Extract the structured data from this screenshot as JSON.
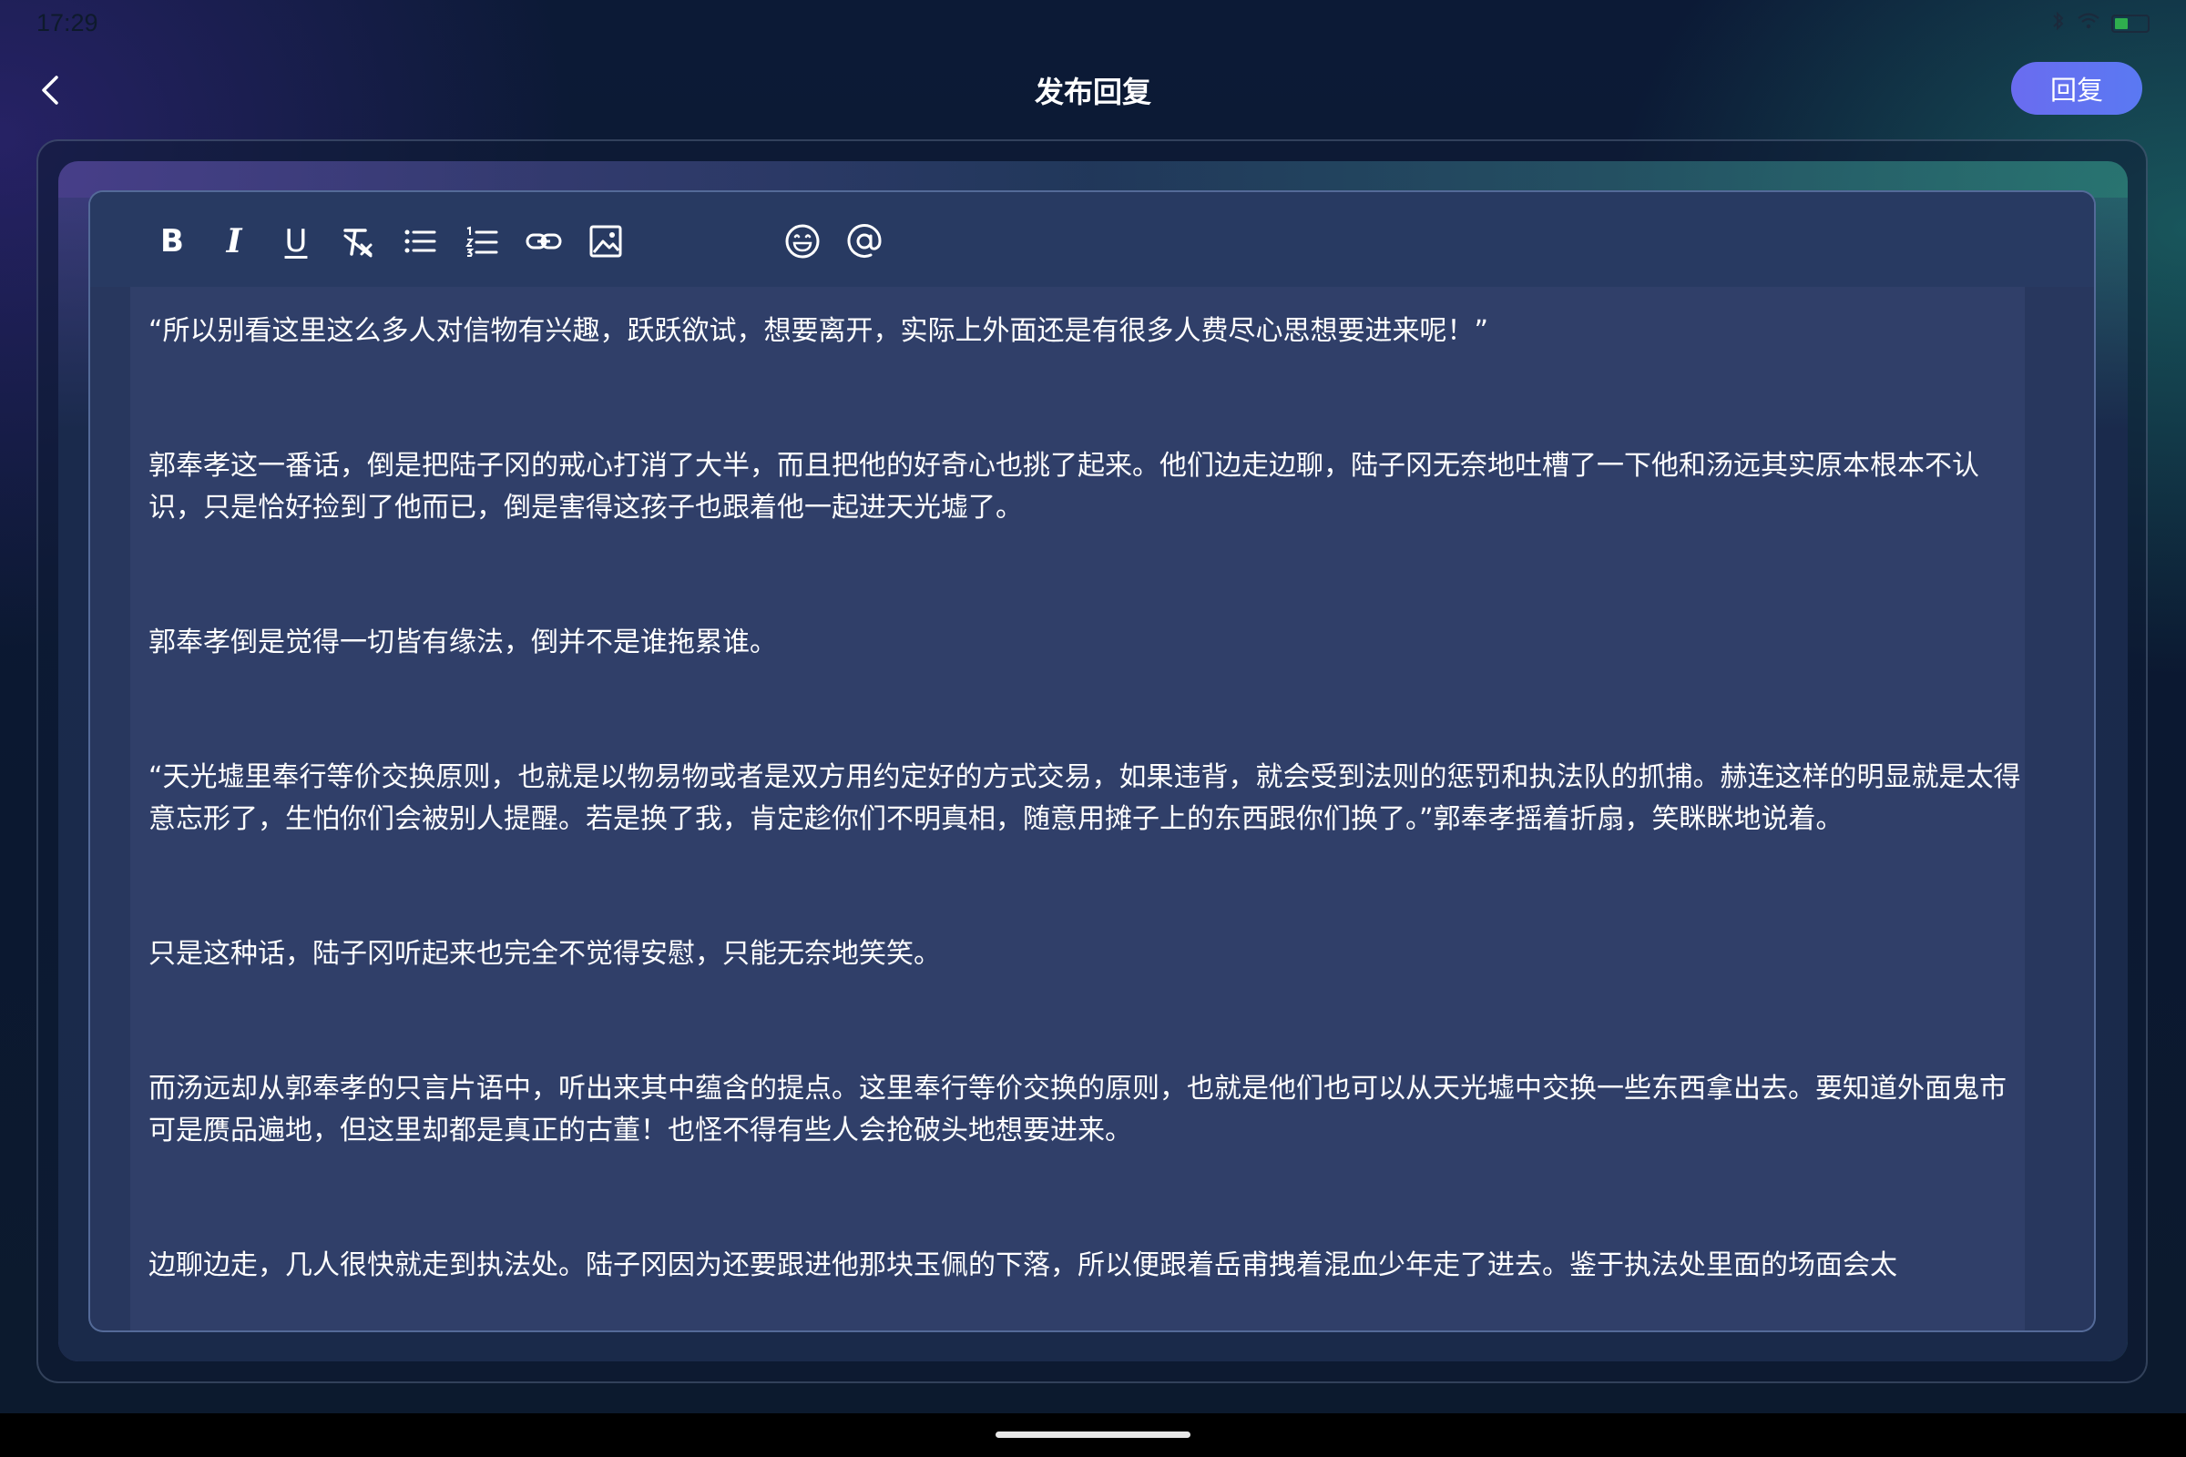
{
  "status_bar": {
    "time": "17:29"
  },
  "header": {
    "title": "发布回复",
    "reply_label": "回复"
  },
  "toolbar": {
    "tools": [
      "bold-icon",
      "italic-icon",
      "underline-icon",
      "clear-format-icon",
      "bullet-list-icon",
      "numbered-list-icon",
      "link-icon",
      "image-icon",
      "emoji-icon",
      "mention-icon"
    ],
    "bold_glyph": "B",
    "italic_glyph": "I",
    "underline_glyph": "U"
  },
  "editor": {
    "paragraphs": [
      "“所以别看这里这么多人对信物有兴趣，跃跃欲试，想要离开，实际上外面还是有很多人费尽心思想要进来呢！”",
      "郭奉孝这一番话，倒是把陆子冈的戒心打消了大半，而且把他的好奇心也挑了起来。他们边走边聊，陆子冈无奈地吐槽了一下他和汤远其实原本根本不认识，只是恰好捡到了他而已，倒是害得这孩子也跟着他一起进天光墟了。",
      "郭奉孝倒是觉得一切皆有缘法，倒并不是谁拖累谁。",
      "“天光墟里奉行等价交换原则，也就是以物易物或者是双方用约定好的方式交易，如果违背，就会受到法则的惩罚和执法队的抓捕。赫连这样的明显就是太得意忘形了，生怕你们会被别人提醒。若是换了我，肯定趁你们不明真相，随意用摊子上的东西跟你们换了。”郭奉孝摇着折扇，笑眯眯地说着。",
      "只是这种话，陆子冈听起来也完全不觉得安慰，只能无奈地笑笑。",
      "而汤远却从郭奉孝的只言片语中，听出来其中蕴含的提点。这里奉行等价交换的原则，也就是他们也可以从天光墟中交换一些东西拿出去。要知道外面鬼市可是赝品遍地，但这里却都是真正的古董！也怪不得有些人会抢破头地想要进来。",
      "边聊边走，几人很快就走到执法处。陆子冈因为还要跟进他那块玉佩的下落，所以便跟着岳甫拽着混血少年走了进去。鉴于执法处里面的场面会太"
    ]
  },
  "colors": {
    "accent": "#6a6cf0",
    "editor_bg": "#303f69",
    "toolbar_bg": "#283a62"
  }
}
